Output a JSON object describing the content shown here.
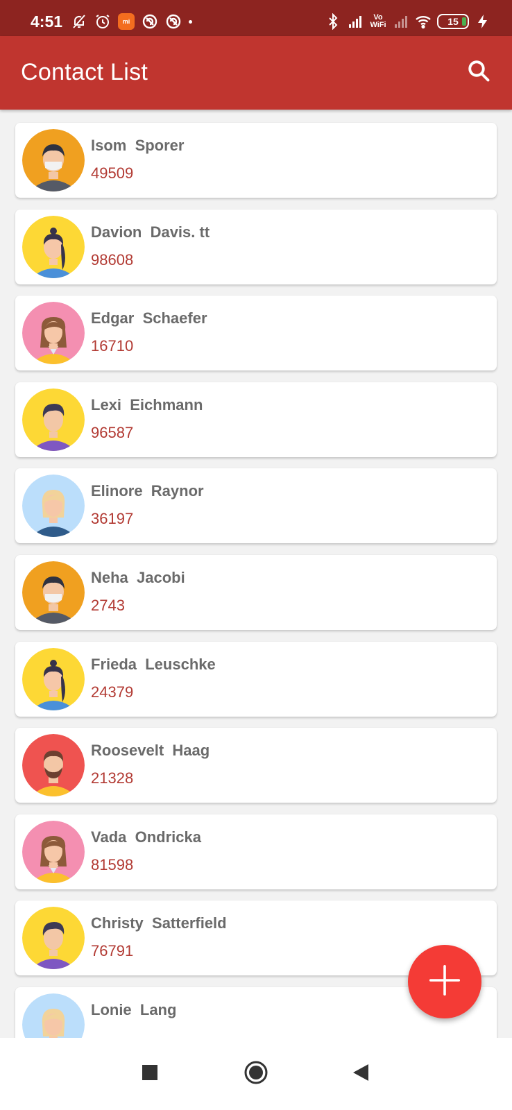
{
  "status_bar": {
    "time": "4:51",
    "battery_level": "15",
    "network_label_top": "Vo",
    "network_label_bottom": "WiFi",
    "notification_badge": "mi",
    "icons": [
      "muted-bell-icon",
      "alarm-icon",
      "mi-app-icon",
      "sync-icon",
      "sync-icon",
      "dot-icon",
      "bluetooth-icon",
      "signal-icon",
      "vowifi-icon",
      "signal-icon",
      "wifi-icon",
      "battery-icon",
      "charging-icon"
    ]
  },
  "app_bar": {
    "title": "Contact List",
    "search_icon": "search-icon",
    "color": "#c0352f"
  },
  "contacts": [
    {
      "first": "Isom",
      "last": "Sporer",
      "number": "49509",
      "avatar": "man-mask-orange"
    },
    {
      "first": "Davion",
      "last": "Davis. tt",
      "number": "98608",
      "avatar": "woman-ponytail-yellow"
    },
    {
      "first": "Edgar",
      "last": "Schaefer",
      "number": "16710",
      "avatar": "woman-brown-pink"
    },
    {
      "first": "Lexi",
      "last": "Eichmann",
      "number": "96587",
      "avatar": "man-purple-yellow"
    },
    {
      "first": "Elinore",
      "last": "Raynor",
      "number": "36197",
      "avatar": "woman-blonde-blue"
    },
    {
      "first": "Neha",
      "last": "Jacobi",
      "number": "2743",
      "avatar": "man-mask-orange"
    },
    {
      "first": "Frieda",
      "last": "Leuschke",
      "number": "24379",
      "avatar": "woman-ponytail-yellow"
    },
    {
      "first": "Roosevelt",
      "last": "Haag",
      "number": "21328",
      "avatar": "man-beard-red"
    },
    {
      "first": "Vada",
      "last": "Ondricka",
      "number": "81598",
      "avatar": "woman-brown-pink"
    },
    {
      "first": "Christy",
      "last": "Satterfield",
      "number": "76791",
      "avatar": "man-purple-yellow"
    },
    {
      "first": "Lonie",
      "last": "Lang",
      "number": "",
      "avatar": "woman-blonde-blue"
    }
  ],
  "fab": {
    "icon": "plus-icon",
    "color": "#f43b36"
  },
  "nav_bar": {
    "icons": [
      "recent-apps-icon",
      "home-icon",
      "back-icon"
    ]
  },
  "colors": {
    "name_text": "#6a6a6a",
    "number_text": "#b23a33",
    "status_bar": "#8d2420"
  }
}
